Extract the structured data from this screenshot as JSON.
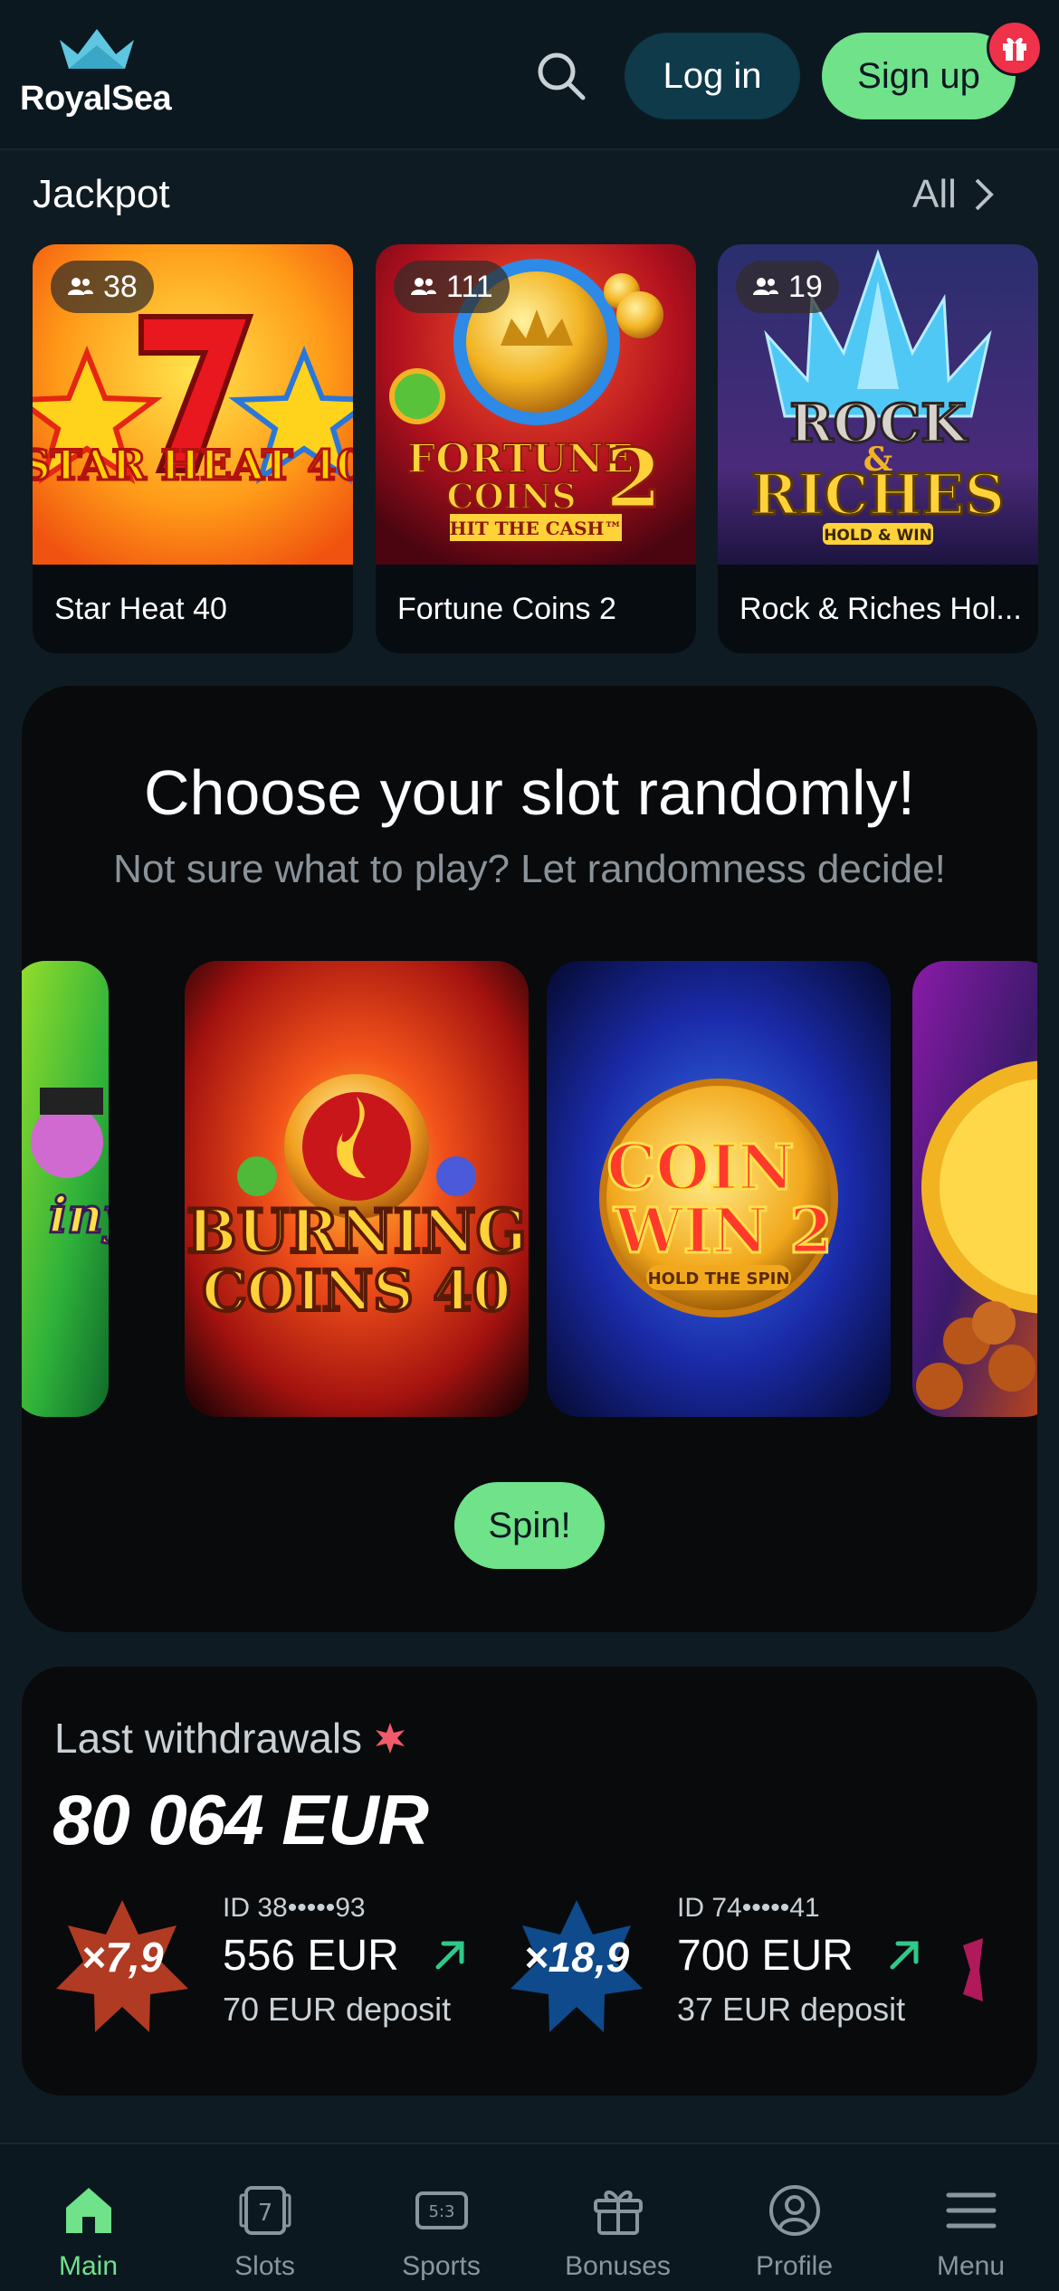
{
  "header": {
    "logo_text": "RoyalSea",
    "login_label": "Log in",
    "signup_label": "Sign up",
    "search_icon": "search-icon",
    "gift_icon": "gift-icon",
    "accent": "#6fe28a",
    "badge_color": "#f0314a"
  },
  "jackpot": {
    "title": "Jackpot",
    "all_label": "All",
    "games": [
      {
        "name": "Star Heat 40",
        "players": "38"
      },
      {
        "name": "Fortune Coins 2",
        "players": "111"
      },
      {
        "name": "Rock & Riches Hol...",
        "players": "19"
      }
    ]
  },
  "random": {
    "title": "Choose your slot randomly!",
    "subtitle": "Not sure what to play? Let randomness decide!",
    "spin_label": "Spin!",
    "slots": [
      {
        "art": "BURNING COINS 40",
        "art_line1": "BURNING",
        "art_line2": "COINS 40"
      },
      {
        "art": "COIN WIN 2",
        "art_line1": "COIN",
        "art_line2": "WIN 2",
        "art_tag": "HOLD THE SPIN"
      }
    ]
  },
  "withdrawals": {
    "label": "Last withdrawals",
    "total": "80 064 EUR",
    "items": [
      {
        "multiplier": "×7,9",
        "id": "ID 38•••••93",
        "amount": "556 EUR",
        "deposit": "70 EUR deposit",
        "star_color": "#b03a22"
      },
      {
        "multiplier": "×18,9",
        "id": "ID 74•••••41",
        "amount": "700 EUR",
        "deposit": "37 EUR deposit",
        "star_color": "#0e4a8c"
      }
    ]
  },
  "nav": {
    "items": [
      {
        "label": "Main",
        "icon": "home-icon",
        "active": true
      },
      {
        "label": "Slots",
        "icon": "slot-machine-icon",
        "active": false
      },
      {
        "label": "Sports",
        "icon": "scoreboard-icon",
        "active": false
      },
      {
        "label": "Bonuses",
        "icon": "gift-icon",
        "active": false
      },
      {
        "label": "Profile",
        "icon": "user-circle-icon",
        "active": false
      },
      {
        "label": "Menu",
        "icon": "hamburger-icon",
        "active": false
      }
    ]
  }
}
